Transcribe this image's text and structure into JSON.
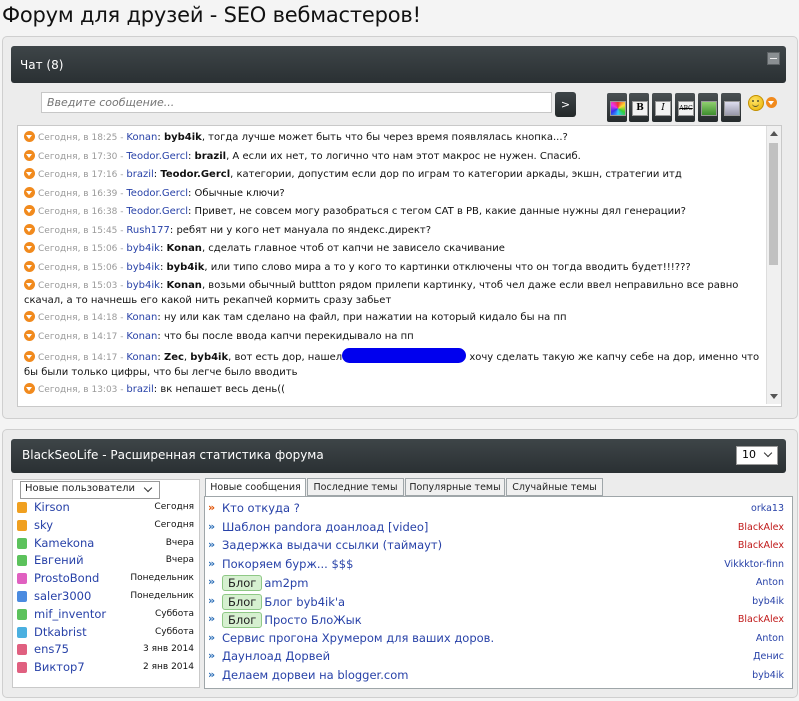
{
  "page_title": "Форум для друзей - SEO вебмастеров!",
  "chat": {
    "title": "Чат (8)",
    "input_placeholder": "Введите сообщение...",
    "send_label": ">",
    "toolbar": [
      {
        "name": "color-palette",
        "label": ""
      },
      {
        "name": "bold",
        "label": "B"
      },
      {
        "name": "italic",
        "label": "I"
      },
      {
        "name": "strike",
        "label": "ABC"
      },
      {
        "name": "insert-image",
        "label": ""
      },
      {
        "name": "insert-link",
        "label": ""
      }
    ],
    "messages": [
      {
        "time": "Сегодня, в 18:25",
        "author": "Konan",
        "to": "byb4ik",
        "text": ", тогда лучше может быть что бы через время появлялась кнопка...?"
      },
      {
        "time": "Сегодня, в 17:30",
        "author": "Teodor.Gercl",
        "to": "brazil",
        "text": ", А если их нет, то логично что нам этот макрос не нужен. Спасиб."
      },
      {
        "time": "Сегодня, в 17:16",
        "author": "brazil",
        "to": "Teodor.Gercl",
        "text": ", категории, допустим если дор по играм то категории аркады, экшн, стратегии итд"
      },
      {
        "time": "Сегодня, в 16:39",
        "author": "Teodor.Gercl",
        "to": "",
        "text": "Обычные ключи?"
      },
      {
        "time": "Сегодня, в 16:38",
        "author": "Teodor.Gercl",
        "to": "",
        "text": "Привет, не совсем могу разобраться с тегом CAT в PB, какие данные нужны дял генерации?"
      },
      {
        "time": "Сегодня, в 15:45",
        "author": "Rush177",
        "to": "",
        "text": "ребят ни у кого нет мануала по яндекс.директ?"
      },
      {
        "time": "Сегодня, в 15:06",
        "author": "byb4ik",
        "to": "Konan",
        "text": ", сделать главное чтоб от капчи не зависело скачивание"
      },
      {
        "time": "Сегодня, в 15:06",
        "author": "byb4ik",
        "to": "byb4ik",
        "text": ", или типо слово мира а то у кого то картинки отключены что он тогда вводить будет!!!???"
      },
      {
        "time": "Сегодня, в 15:03",
        "author": "byb4ik",
        "to": "Konan",
        "text": ", возьми обычный buttton рядом прилепи картинку, чтоб чел даже если ввел неправильно все равно скачал, а то начнешь его какой нить рекапчей кормить сразу забьет"
      },
      {
        "time": "Сегодня, в 14:18",
        "author": "Konan",
        "to": "",
        "text": "ну или как там сделано на файл, при нажатии на который кидало бы на пп"
      },
      {
        "time": "Сегодня, в 14:17",
        "author": "Konan",
        "to": "",
        "text": "что бы после ввода капчи перекидывало на пп"
      },
      {
        "time": "Сегодня, в 14:17",
        "author": "Konan",
        "to": "Zec",
        "to2": "byb4ik",
        "text_a": ", вот есть дор, нашел",
        "text_b": " хочу сделать такую же капчу себе на дор, именно что бы были только цифры, что бы легче было вводить"
      },
      {
        "time": "Сегодня, в 13:03",
        "author": "brazil",
        "to": "",
        "text": "вк непашет весь день(("
      }
    ]
  },
  "stats": {
    "title": "BlackSeoLife - Расширенная статистика форума",
    "count_value": "10",
    "users_select": "Новые пользователи",
    "users": [
      {
        "name": "Kirson",
        "date": "Сегодня",
        "color": "#f0a020"
      },
      {
        "name": "sky",
        "date": "Сегодня",
        "color": "#f0a020"
      },
      {
        "name": "Kamekona",
        "date": "Вчера",
        "color": "#5cc25c"
      },
      {
        "name": "Евгений",
        "date": "Вчера",
        "color": "#5cc25c"
      },
      {
        "name": "ProstoBond",
        "date": "Понедельник",
        "color": "#e060c0"
      },
      {
        "name": "saler3000",
        "date": "Понедельник",
        "color": "#4b8be0"
      },
      {
        "name": "mif_inventor",
        "date": "Суббота",
        "color": "#5cc25c"
      },
      {
        "name": "Dtkabrist",
        "date": "Суббота",
        "color": "#4bb0e0"
      },
      {
        "name": "ens75",
        "date": "3 янв 2014",
        "color": "#e06080"
      },
      {
        "name": "Виктор7",
        "date": "2 янв 2014",
        "color": "#e06080"
      }
    ],
    "tabs": [
      "Новые сообщения",
      "Последние темы",
      "Популярные темы",
      "Случайные темы"
    ],
    "topics": [
      {
        "badge": "",
        "title": "Кто откуда ?",
        "author": "orka13",
        "author_color": "#2842a8"
      },
      {
        "badge": "",
        "title": "Шаблон pandora доанлоад [video]",
        "author": "BlackAlex",
        "author_color": "#c01818"
      },
      {
        "badge": "",
        "title": "Задержка выдачи ссылки (таймаут)",
        "author": "BlackAlex",
        "author_color": "#c01818"
      },
      {
        "badge": "",
        "title": "Покоряем бурж... $$$",
        "author": "Vikkktor-finn",
        "author_color": "#2842a8"
      },
      {
        "badge": "Блог",
        "title": "am2pm",
        "author": "Anton",
        "author_color": "#2842a8"
      },
      {
        "badge": "Блог",
        "title": "Блог byb4ik'a",
        "author": "byb4ik",
        "author_color": "#2842a8"
      },
      {
        "badge": "Блог",
        "title": "Просто БлоЖык",
        "author": "BlackAlex",
        "author_color": "#c01818"
      },
      {
        "badge": "",
        "title": "Сервис прогона Хрумером для ваших доров.",
        "author": "Anton",
        "author_color": "#2842a8"
      },
      {
        "badge": "",
        "title": "Даунлоад Дорвей",
        "author": "Денис",
        "author_color": "#2842a8"
      },
      {
        "badge": "",
        "title": "Делаем дорвеи на blogger.com",
        "author": "byb4ik",
        "author_color": "#2842a8"
      }
    ]
  }
}
